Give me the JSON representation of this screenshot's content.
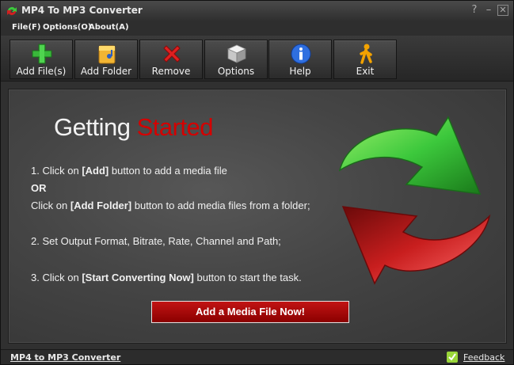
{
  "window": {
    "title": "MP4 To MP3 Converter"
  },
  "controls": {
    "help": "?",
    "minimize": "–",
    "close": "✕"
  },
  "menu": {
    "items": [
      {
        "label": "File(F)"
      },
      {
        "label": "Options(O)"
      },
      {
        "label": "About(A)"
      }
    ]
  },
  "toolbar": {
    "buttons": [
      {
        "label": "Add File(s)",
        "icon": "plus-icon"
      },
      {
        "label": "Add Folder",
        "icon": "folder-icon"
      },
      {
        "label": "Remove",
        "icon": "remove-icon"
      },
      {
        "label": "Options",
        "icon": "cube-icon"
      },
      {
        "label": "Help",
        "icon": "info-icon"
      },
      {
        "label": "Exit",
        "icon": "running-man-icon"
      }
    ]
  },
  "main": {
    "heading_part1": "Getting ",
    "heading_part2": "Started",
    "step1_prefix": "1. Click on ",
    "step1_bold": "[Add]",
    "step1_suffix": " button to add a media file",
    "or": "OR",
    "step1b_prefix": "Click on ",
    "step1b_bold": "[Add Folder]",
    "step1b_suffix": " button to add media files from a folder;",
    "step2": "2. Set Output Format, Bitrate, Rate, Channel and Path;",
    "step3_prefix": "3. Click on ",
    "step3_bold": "[Start Converting Now]",
    "step3_suffix": " button to start the task.",
    "cta_label": "Add a Media File Now!"
  },
  "status": {
    "left": "MP4 to MP3 Converter",
    "right": "Feedback"
  },
  "colors": {
    "accent_red": "#d40000",
    "arrow_green": "#3cc83c",
    "arrow_red": "#c81e1e"
  }
}
